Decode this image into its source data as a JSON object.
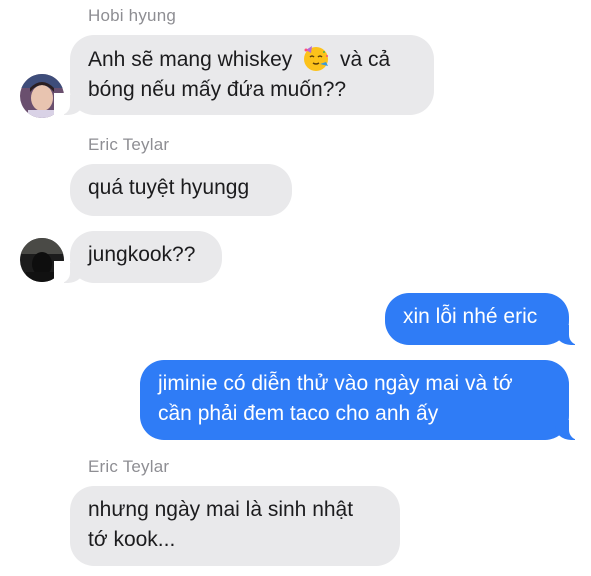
{
  "messages": [
    {
      "sender": "Hobi hyung",
      "lines": [
        "Anh sẽ mang whiskey",
        "và cả",
        "bóng nếu mấy đứa muốn??"
      ],
      "emoji": "partying-face-icon"
    },
    {
      "sender": "Eric Teylar",
      "lines": [
        "quá tuyệt hyungg"
      ]
    },
    {
      "lines": [
        "jungkook??"
      ]
    },
    {
      "lines": [
        "xin lỗi nhé eric"
      ]
    },
    {
      "lines": [
        "jiminie có diễn thử vào ngày mai và tớ",
        "cần phải đem taco cho anh ấy"
      ]
    },
    {
      "sender": "Eric Teylar",
      "lines": [
        "nhưng ngày mai là sinh nhật",
        "tớ kook..."
      ]
    }
  ],
  "colors": {
    "incoming_bubble": "#e9e9eb",
    "outgoing_bubble": "#2f7cf6",
    "sender_name": "#8e8e93"
  }
}
